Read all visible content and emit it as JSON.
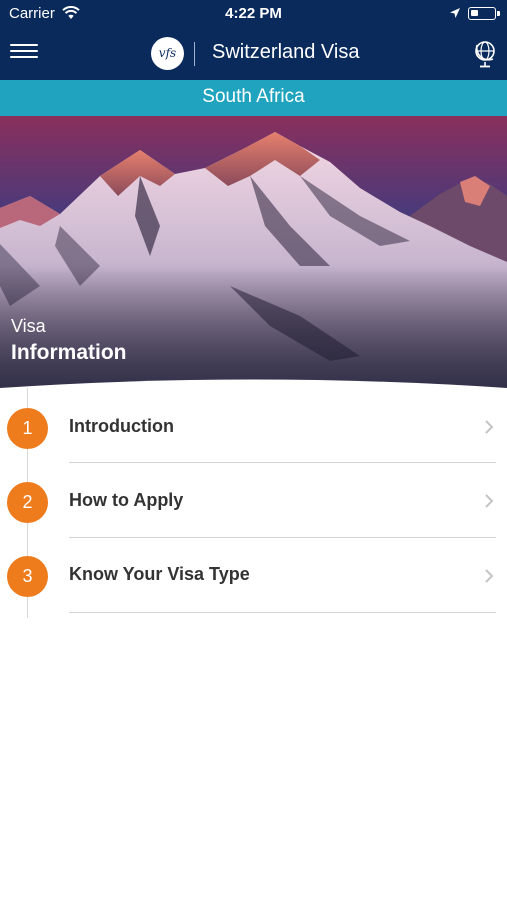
{
  "status_bar": {
    "carrier": "Carrier",
    "time": "4:22 PM"
  },
  "nav": {
    "logo_text": "vfs",
    "title": "Switzerland Visa",
    "menu_icon": "hamburger-menu-icon",
    "globe_icon": "globe-icon"
  },
  "country": "South Africa",
  "hero": {
    "label_small": "Visa",
    "label_big": "Information"
  },
  "menu_items": [
    {
      "number": "1",
      "label": "Introduction"
    },
    {
      "number": "2",
      "label": "How to Apply"
    },
    {
      "number": "3",
      "label": "Know Your Visa Type"
    }
  ],
  "colors": {
    "nav_bg": "#0a2a5c",
    "country_bar": "#1fa3bf",
    "accent_orange": "#ee7b1c"
  }
}
